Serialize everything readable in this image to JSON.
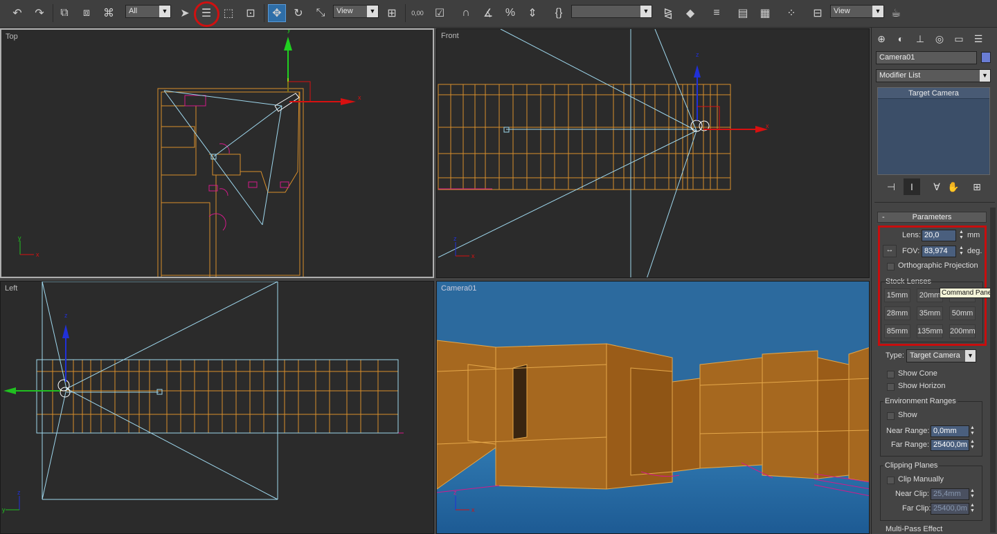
{
  "toolbar": {
    "selection_filter": "All",
    "ref_coord_system": "View",
    "named_selection": "",
    "ref_coord_system_2": "View",
    "percent_snap_label": "0,00"
  },
  "viewports": {
    "top": {
      "label": "Top"
    },
    "front": {
      "label": "Front"
    },
    "left": {
      "label": "Left"
    },
    "camera": {
      "label": "Camera01"
    }
  },
  "panel": {
    "object_name": "Camera01",
    "object_color": "#6a7dd4",
    "modifier_list": "Modifier List",
    "stack_items": [
      "Target Camera"
    ],
    "parameters": {
      "title": "Parameters",
      "collapse": "-",
      "lens_label": "Lens:",
      "lens_value": "20,0",
      "lens_unit": "mm",
      "fov_label": "FOV:",
      "fov_value": "83,974",
      "fov_unit": "deg.",
      "ortho_label": "Orthographic Projection",
      "stock_lenses_label": "Stock Lenses",
      "stock_lenses": [
        "15mm",
        "20mm",
        "24mm",
        "28mm",
        "35mm",
        "50mm",
        "85mm",
        "135mm",
        "200mm"
      ],
      "type_label": "Type:",
      "type_value": "Target Camera",
      "show_cone": "Show Cone",
      "show_horizon": "Show Horizon",
      "env_ranges_label": "Environment Ranges",
      "env_show": "Show",
      "near_range_label": "Near Range:",
      "near_range_value": "0,0mm",
      "far_range_label": "Far Range:",
      "far_range_value": "25400,0m",
      "clipping_label": "Clipping Planes",
      "clip_manually": "Clip Manually",
      "near_clip_label": "Near Clip:",
      "near_clip_value": "25,4mm",
      "far_clip_label": "Far Clip:",
      "far_clip_value": "25400,0m",
      "multipass_label": "Multi-Pass Effect"
    },
    "tooltip": "Command Panel"
  },
  "colors": {
    "toolbar_bg": "#3f3f3f",
    "viewport_bg": "#2b2b2b",
    "camera_bg": "#2c6a9e",
    "wall_color": "#d98f2b",
    "wire_color": "#9fd8ee",
    "highlight_red": "#c80d0d"
  }
}
